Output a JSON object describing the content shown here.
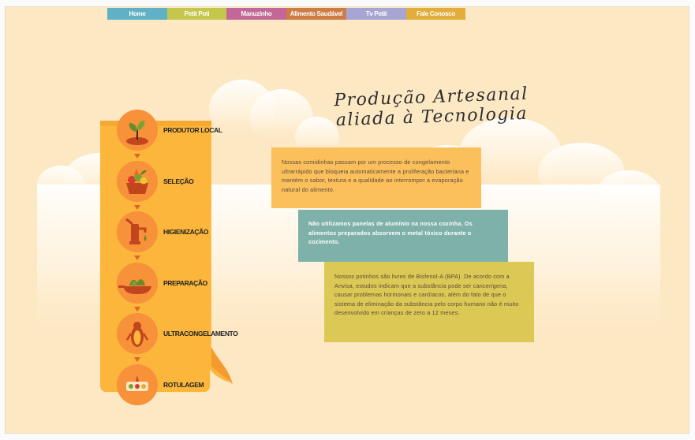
{
  "nav": {
    "items": [
      {
        "label": "Home"
      },
      {
        "label": "Petit Poti"
      },
      {
        "label": "Manuzinho"
      },
      {
        "label": "Alimento Saudável"
      },
      {
        "label": "Tv Petit"
      },
      {
        "label": "Fale Conosco"
      }
    ]
  },
  "title": {
    "line1": "Produção Artesanal",
    "line2": "aliada à Tecnologia"
  },
  "steps": [
    {
      "label": "PRODUTOR LOCAL",
      "icon": "sprout-icon"
    },
    {
      "label": "SELEÇÃO",
      "icon": "vegetable-basket-icon"
    },
    {
      "label": "HIGIENIZAÇÃO",
      "icon": "water-pump-icon"
    },
    {
      "label": "PREPARAÇÃO",
      "icon": "cooking-pan-icon"
    },
    {
      "label": "ULTRACONGELAMENTO",
      "icon": "penguin-icon"
    },
    {
      "label": "ROTULAGEM",
      "icon": "petit-poti-label-icon"
    }
  ],
  "boxes": {
    "box1": "Nossas comidinhas passam por um processo de congelamento ultrarrápido que bloqueia automaticamente a proliferação bacteriana e mantém o sabor, textura e a qualidade ao interromper a evaporação natural do alimento.",
    "box2": "Não utilizamos panelas de alumínio na nossa cozinha. Os alimentos preparados absorvem o metal tóxico durante o cozimento.",
    "box3": "Nossos potinhos são livres de Bisfenol-A (BPA). De acordo com a Anvisa, estudos indicam que a substância pode ser cancerígena, causar problemas hormonais e cardíacos, além do fato de que o sistema de eliminação da substância pelo corpo humano não é muito desenvolvido em crianças de zero a 12 meses."
  },
  "colors": {
    "background": "#fde8c4",
    "panel": "#fbb63b",
    "circle": "#f7913a",
    "box1": "#fbbf5c",
    "box2": "#7eb1aa",
    "box3": "#dcc855"
  }
}
